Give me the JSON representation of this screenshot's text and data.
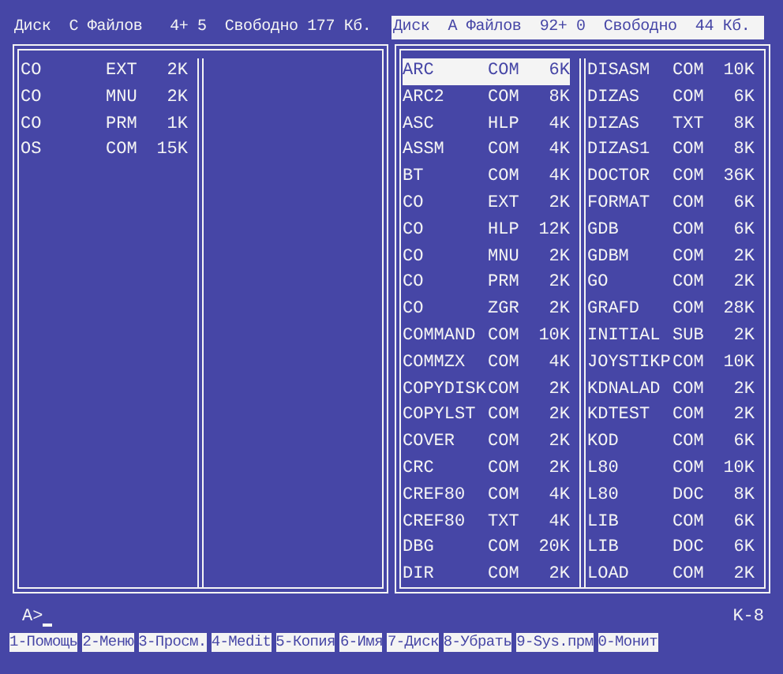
{
  "panels": [
    {
      "header": "Диск  С Файлов   4+ 5  Свободно 177 Кб.",
      "active": false,
      "columns": [
        {
          "files": [
            {
              "name": "CO",
              "ext": "EXT",
              "size": "2K",
              "selected": false
            },
            {
              "name": "CO",
              "ext": "MNU",
              "size": "2K",
              "selected": false
            },
            {
              "name": "CO",
              "ext": "PRM",
              "size": "1K",
              "selected": false
            },
            {
              "name": "OS",
              "ext": "COM",
              "size": "15K",
              "selected": false
            }
          ]
        }
      ]
    },
    {
      "header": "Диск  А Файлов  92+ 0  Свободно  44 Кб.",
      "active": true,
      "columns": [
        {
          "files": [
            {
              "name": "ARC",
              "ext": "COM",
              "size": "6K",
              "selected": true
            },
            {
              "name": "ARC2",
              "ext": "COM",
              "size": "8K",
              "selected": false
            },
            {
              "name": "ASC",
              "ext": "HLP",
              "size": "4K",
              "selected": false
            },
            {
              "name": "ASSM",
              "ext": "COM",
              "size": "4K",
              "selected": false
            },
            {
              "name": "BT",
              "ext": "COM",
              "size": "4K",
              "selected": false
            },
            {
              "name": "CO",
              "ext": "EXT",
              "size": "2K",
              "selected": false
            },
            {
              "name": "CO",
              "ext": "HLP",
              "size": "12K",
              "selected": false
            },
            {
              "name": "CO",
              "ext": "MNU",
              "size": "2K",
              "selected": false
            },
            {
              "name": "CO",
              "ext": "PRM",
              "size": "2K",
              "selected": false
            },
            {
              "name": "CO",
              "ext": "ZGR",
              "size": "2K",
              "selected": false
            },
            {
              "name": "COMMAND",
              "ext": "COM",
              "size": "10K",
              "selected": false
            },
            {
              "name": "COMMZX",
              "ext": "COM",
              "size": "4K",
              "selected": false
            },
            {
              "name": "COPYDISK",
              "ext": "COM",
              "size": "2K",
              "selected": false
            },
            {
              "name": "COPYLST",
              "ext": "COM",
              "size": "2K",
              "selected": false
            },
            {
              "name": "COVER",
              "ext": "COM",
              "size": "2K",
              "selected": false
            },
            {
              "name": "CRC",
              "ext": "COM",
              "size": "2K",
              "selected": false
            },
            {
              "name": "CREF80",
              "ext": "COM",
              "size": "4K",
              "selected": false
            },
            {
              "name": "CREF80",
              "ext": "TXT",
              "size": "4K",
              "selected": false
            },
            {
              "name": "DBG",
              "ext": "COM",
              "size": "20K",
              "selected": false
            },
            {
              "name": "DIR",
              "ext": "COM",
              "size": "2K",
              "selected": false
            }
          ]
        },
        {
          "files": [
            {
              "name": "DISASM",
              "ext": "COM",
              "size": "10K",
              "selected": false
            },
            {
              "name": "DIZAS",
              "ext": "COM",
              "size": "6K",
              "selected": false
            },
            {
              "name": "DIZAS",
              "ext": "TXT",
              "size": "8K",
              "selected": false
            },
            {
              "name": "DIZAS1",
              "ext": "COM",
              "size": "8K",
              "selected": false
            },
            {
              "name": "DOCTOR",
              "ext": "COM",
              "size": "36K",
              "selected": false
            },
            {
              "name": "FORMAT",
              "ext": "COM",
              "size": "6K",
              "selected": false
            },
            {
              "name": "GDB",
              "ext": "COM",
              "size": "6K",
              "selected": false
            },
            {
              "name": "GDBM",
              "ext": "COM",
              "size": "2K",
              "selected": false
            },
            {
              "name": "GO",
              "ext": "COM",
              "size": "2K",
              "selected": false
            },
            {
              "name": "GRAFD",
              "ext": "COM",
              "size": "28K",
              "selected": false
            },
            {
              "name": "INITIAL",
              "ext": "SUB",
              "size": "2K",
              "selected": false
            },
            {
              "name": "JOYSTIKP",
              "ext": "COM",
              "size": "10K",
              "selected": false
            },
            {
              "name": "KDNALAD",
              "ext": "COM",
              "size": "2K",
              "selected": false
            },
            {
              "name": "KDTEST",
              "ext": "COM",
              "size": "2K",
              "selected": false
            },
            {
              "name": "KOD",
              "ext": "COM",
              "size": "6K",
              "selected": false
            },
            {
              "name": "L80",
              "ext": "COM",
              "size": "10K",
              "selected": false
            },
            {
              "name": "L80",
              "ext": "DOC",
              "size": "8K",
              "selected": false
            },
            {
              "name": "LIB",
              "ext": "COM",
              "size": "6K",
              "selected": false
            },
            {
              "name": "LIB",
              "ext": "DOC",
              "size": "6K",
              "selected": false
            },
            {
              "name": "LOAD",
              "ext": "COM",
              "size": "2K",
              "selected": false
            }
          ]
        }
      ]
    }
  ],
  "command_line": {
    "prompt": "A>",
    "indicator": "K-8"
  },
  "function_keys": [
    "1-Помощь",
    "2-Меню",
    "3-Просм.",
    "4-Medit",
    "5-Копия",
    "6-Имя",
    "7-Диск",
    "8-Убрать",
    "9-Sys.прм",
    "0-Монит"
  ]
}
